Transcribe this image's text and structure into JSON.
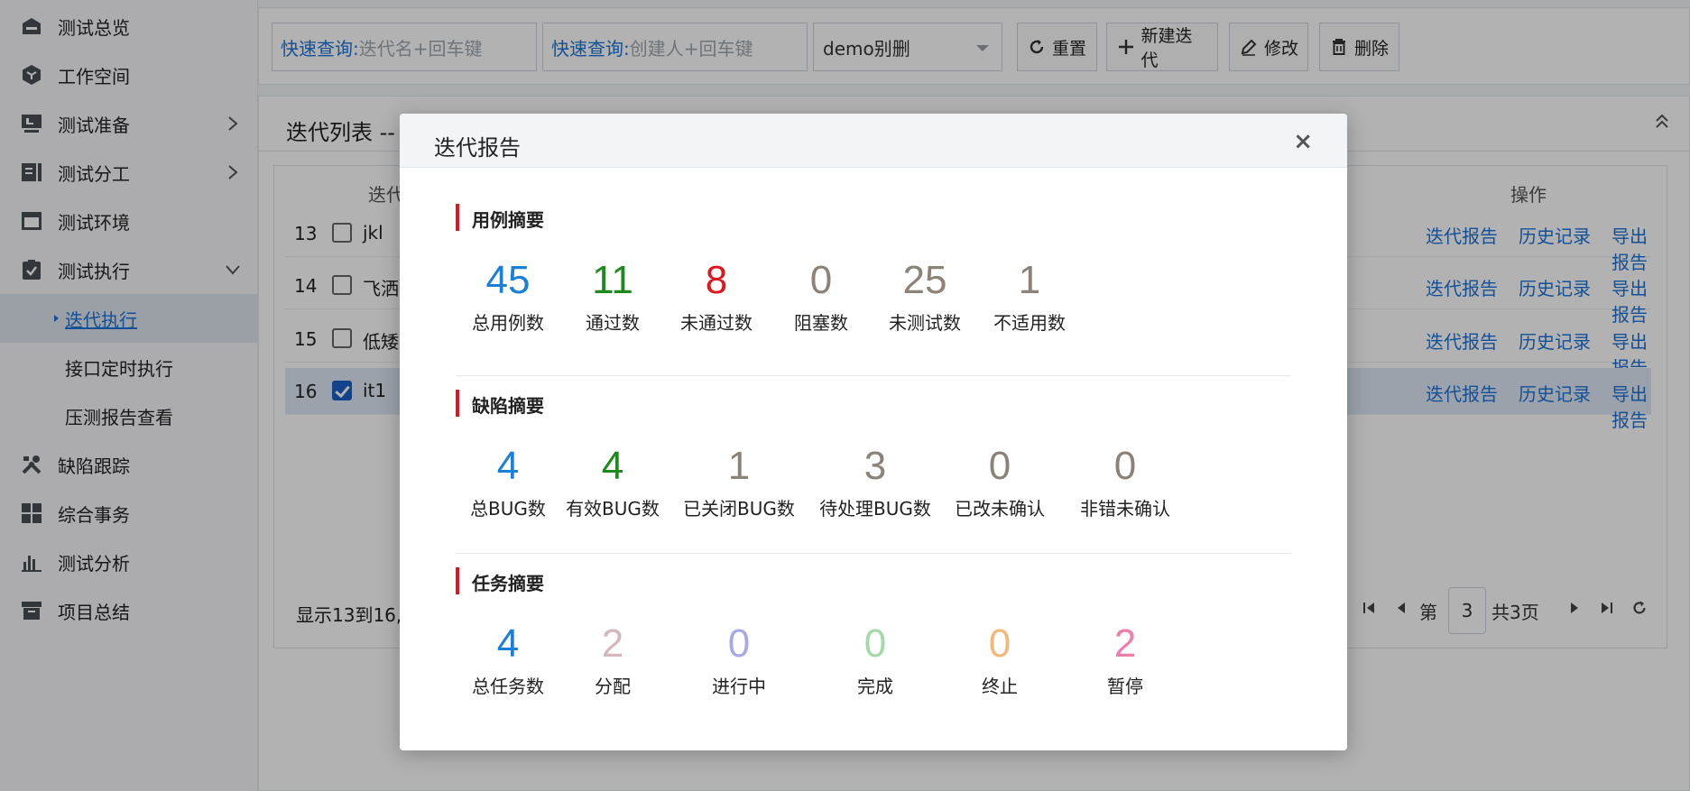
{
  "sidebar": {
    "items": [
      {
        "label": "测试总览",
        "icon": "dashboard-icon"
      },
      {
        "label": "工作空间",
        "icon": "cube-icon"
      },
      {
        "label": "测试准备",
        "icon": "monitor-icon"
      },
      {
        "label": "测试分工",
        "icon": "split-icon"
      },
      {
        "label": "测试环境",
        "icon": "window-icon"
      },
      {
        "label": "测试执行",
        "icon": "clipboard-check-icon"
      },
      {
        "label": "缺陷跟踪",
        "icon": "tools-icon"
      },
      {
        "label": "综合事务",
        "icon": "grid-icon"
      },
      {
        "label": "测试分析",
        "icon": "bar-chart-icon"
      },
      {
        "label": "项目总结",
        "icon": "archive-icon"
      }
    ],
    "sub_items": [
      {
        "label": "迭代执行",
        "active": true
      },
      {
        "label": "接口定时执行",
        "active": false
      },
      {
        "label": "压测报告查看",
        "active": false
      }
    ]
  },
  "toolbar": {
    "search1_prefix": "快速查询:",
    "search1_placeholder": "迭代名+回车键",
    "search2_prefix": "快速查询:",
    "search2_placeholder": "创建人+回车键",
    "select_value": "demo别删",
    "reset_label": "重置",
    "new_label": "新建迭代",
    "edit_label": "修改",
    "delete_label": "删除"
  },
  "panel": {
    "title": "迭代列表 --",
    "col_name": "迭代",
    "col_ops": "操作",
    "rows": [
      {
        "no": "13",
        "name": "jkl",
        "checked": false
      },
      {
        "no": "14",
        "name": "飞洒",
        "checked": false
      },
      {
        "no": "15",
        "name": "低矮",
        "checked": false
      },
      {
        "no": "16",
        "name": "it1",
        "checked": true
      }
    ],
    "row_actions": [
      "迭代报告",
      "历史记录",
      "导出报告"
    ],
    "footer": "显示13到16,",
    "pager": {
      "prefix": "第",
      "page": "3",
      "total": "共3页"
    }
  },
  "modal": {
    "title": "迭代报告",
    "close": "×",
    "case_summary": {
      "title": "用例摘要",
      "stats": [
        {
          "value": "45",
          "label": "总用例数",
          "color": "#1a7fd9"
        },
        {
          "value": "11",
          "label": "通过数",
          "color": "#1e8a1e"
        },
        {
          "value": "8",
          "label": "未通过数",
          "color": "#e0161f"
        },
        {
          "value": "0",
          "label": "阻塞数",
          "color": "#8c8378"
        },
        {
          "value": "25",
          "label": "未测试数",
          "color": "#8c8378"
        },
        {
          "value": "1",
          "label": "不适用数",
          "color": "#8c8378"
        }
      ]
    },
    "bug_summary": {
      "title": "缺陷摘要",
      "stats": [
        {
          "value": "4",
          "label": "总BUG数",
          "color": "#1a7fd9"
        },
        {
          "value": "4",
          "label": "有效BUG数",
          "color": "#1e8a1e"
        },
        {
          "value": "1",
          "label": "已关闭BUG数",
          "color": "#8c8378"
        },
        {
          "value": "3",
          "label": "待处理BUG数",
          "color": "#8c8378"
        },
        {
          "value": "0",
          "label": "已改未确认",
          "color": "#8c8378"
        },
        {
          "value": "0",
          "label": "非错未确认",
          "color": "#8c8378"
        }
      ]
    },
    "task_summary": {
      "title": "任务摘要",
      "stats": [
        {
          "value": "4",
          "label": "总任务数",
          "color": "#1a7fd9"
        },
        {
          "value": "2",
          "label": "分配",
          "color": "#d4b8bd"
        },
        {
          "value": "0",
          "label": "进行中",
          "color": "#a9a8e6"
        },
        {
          "value": "0",
          "label": "完成",
          "color": "#a3d9a6"
        },
        {
          "value": "0",
          "label": "终止",
          "color": "#f0b97a"
        },
        {
          "value": "2",
          "label": "暂停",
          "color": "#f07eaa"
        }
      ]
    }
  }
}
